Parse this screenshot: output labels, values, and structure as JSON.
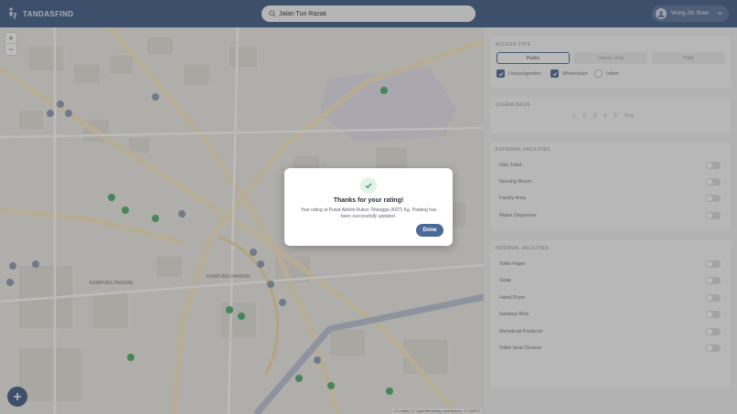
{
  "header": {
    "brand": "TANDASFIND",
    "search_value": "Jalan Tun Razak",
    "user_name": "Wong Zhi Shen"
  },
  "map": {
    "district_labels": [
      "KAMPUNG PANDAN",
      "KAMPUNG PANDAN"
    ],
    "attribution": "© Leaflet | © OpenStreetMap contributors, © CARTO"
  },
  "filters": {
    "access_type_title": "ACCESS TYPE",
    "access_options": [
      {
        "label": "Public",
        "active": true
      },
      {
        "label": "Owner Only",
        "active": false
      },
      {
        "label": "Paid",
        "active": false
      }
    ],
    "gender_options": [
      {
        "label": "Unisex/gender",
        "checked": true
      },
      {
        "label": "Wheelchair",
        "checked": true
      },
      {
        "label": "Infant",
        "checked": false
      }
    ],
    "cleanliness_title": "CLEANLINESS",
    "cleanliness_levels": [
      "1",
      "2",
      "3",
      "4",
      "5",
      "Any"
    ],
    "external_title": "EXTERNAL FACILITIES",
    "external": [
      "Otto Toilet",
      "Nursing Room",
      "Family Area",
      "Water Dispenser"
    ],
    "internal_title": "INTERNAL FACILITIES",
    "internal": [
      "Toilet Paper",
      "Soap",
      "Hand Dryer",
      "Sanitary Bins",
      "Menstrual Products",
      "Toilet Seat Cleaner"
    ]
  },
  "modal": {
    "title": "Thanks for your rating!",
    "body": "Your rating at Pusat Aktiviti Rukun Tetangga (KRT) Kg. Padang has been successfully updated.",
    "done_label": "Done"
  },
  "colors": {
    "header": "#3f5b85",
    "accent": "#4b6a97",
    "pin_green": "#4cae6b",
    "pin_gray": "#8c9bb3"
  }
}
